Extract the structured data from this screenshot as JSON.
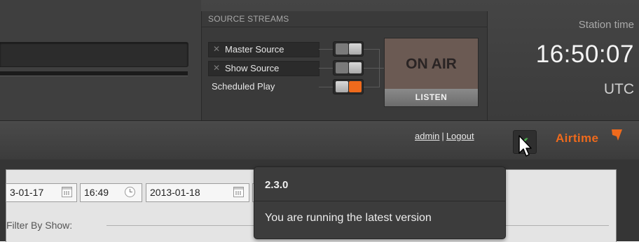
{
  "source_streams": {
    "title": "SOURCE STREAMS",
    "sources": [
      {
        "label": "Master Source",
        "status": "off"
      },
      {
        "label": "Show Source",
        "status": "off"
      },
      {
        "label": "Scheduled Play",
        "status": "on"
      }
    ],
    "on_air_label": "ON AIR",
    "listen_label": "LISTEN"
  },
  "station_time": {
    "label": "Station time",
    "time": "16:50:07",
    "timezone": "UTC"
  },
  "nav": {
    "user": "admin",
    "separator": "|",
    "logout": "Logout",
    "brand": "Airtime"
  },
  "filters": {
    "start_date": "3-01-17",
    "start_time": "16:49",
    "end_date": "2013-01-18",
    "filter_by_show_label": "Filter By Show:"
  },
  "tooltip": {
    "version": "2.3.0",
    "message": "You are running the latest version"
  },
  "colors": {
    "accent": "#ef6a1c",
    "check": "#4cb050",
    "header_bg": "#3f3f3f"
  },
  "icons": {
    "version_status": "check-icon",
    "date": "calendar-icon",
    "time": "clock-icon",
    "pointer": "cursor-icon"
  }
}
